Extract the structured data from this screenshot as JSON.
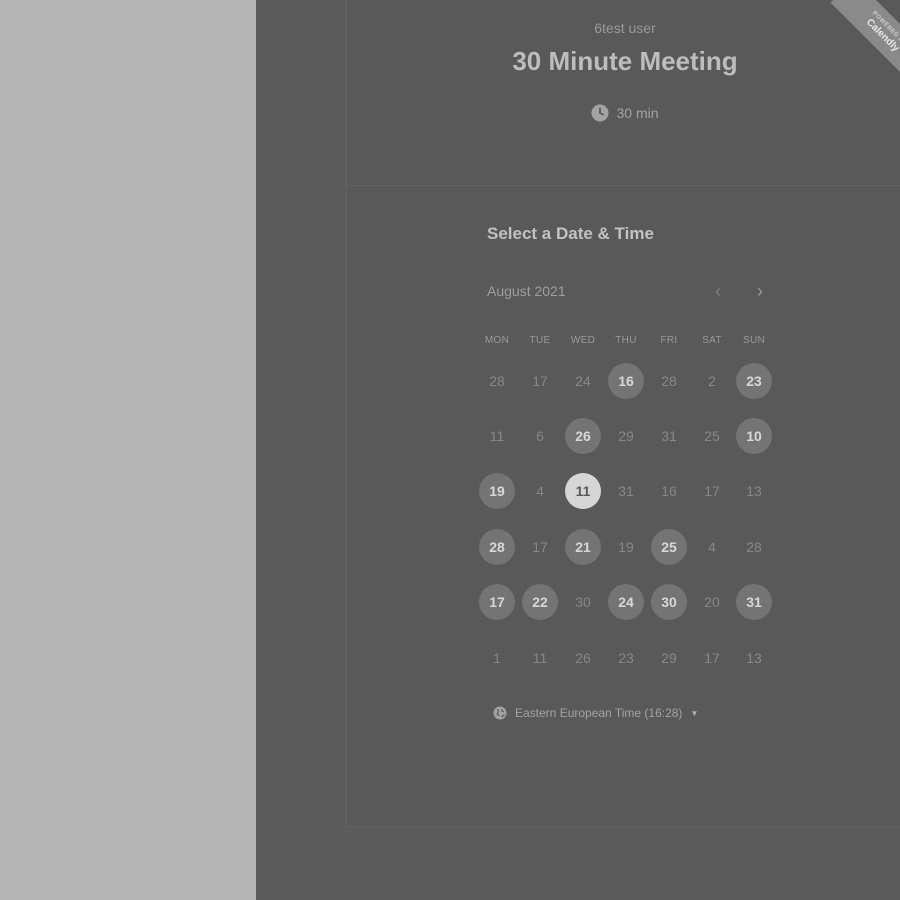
{
  "colors": {
    "left_pane": "#b5b5b5",
    "right_pane": "#5c5c5c",
    "card": "#595959",
    "available_day": "#747474",
    "selected_day": "#d6d6d6"
  },
  "ribbon": {
    "small": "POWERED BY",
    "brand": "Calendly"
  },
  "event": {
    "host": "6test user",
    "title": "30 Minute Meeting",
    "duration": "30 min",
    "duration_icon": "clock-icon"
  },
  "calendar": {
    "heading": "Select a Date & Time",
    "month": "August 2021",
    "prev_icon": "chevron-left-icon",
    "next_icon": "chevron-right-icon",
    "weekdays": [
      "MON",
      "TUE",
      "WED",
      "THU",
      "FRI",
      "SAT",
      "SUN"
    ],
    "weeks": [
      [
        {
          "d": "28",
          "s": "unavailable"
        },
        {
          "d": "17",
          "s": "unavailable"
        },
        {
          "d": "24",
          "s": "unavailable"
        },
        {
          "d": "16",
          "s": "available"
        },
        {
          "d": "28",
          "s": "unavailable"
        },
        {
          "d": "2",
          "s": "unavailable"
        },
        {
          "d": "23",
          "s": "available"
        }
      ],
      [
        {
          "d": "11",
          "s": "unavailable"
        },
        {
          "d": "6",
          "s": "unavailable"
        },
        {
          "d": "26",
          "s": "available"
        },
        {
          "d": "29",
          "s": "unavailable"
        },
        {
          "d": "31",
          "s": "unavailable"
        },
        {
          "d": "25",
          "s": "unavailable"
        },
        {
          "d": "10",
          "s": "available"
        }
      ],
      [
        {
          "d": "19",
          "s": "available"
        },
        {
          "d": "4",
          "s": "unavailable"
        },
        {
          "d": "11",
          "s": "selected"
        },
        {
          "d": "31",
          "s": "unavailable"
        },
        {
          "d": "16",
          "s": "unavailable"
        },
        {
          "d": "17",
          "s": "unavailable"
        },
        {
          "d": "13",
          "s": "unavailable"
        }
      ],
      [
        {
          "d": "28",
          "s": "available"
        },
        {
          "d": "17",
          "s": "unavailable"
        },
        {
          "d": "21",
          "s": "available"
        },
        {
          "d": "19",
          "s": "unavailable"
        },
        {
          "d": "25",
          "s": "available"
        },
        {
          "d": "4",
          "s": "unavailable"
        },
        {
          "d": "28",
          "s": "unavailable"
        }
      ],
      [
        {
          "d": "17",
          "s": "available"
        },
        {
          "d": "22",
          "s": "available"
        },
        {
          "d": "30",
          "s": "unavailable"
        },
        {
          "d": "24",
          "s": "available"
        },
        {
          "d": "30",
          "s": "available"
        },
        {
          "d": "20",
          "s": "unavailable"
        },
        {
          "d": "31",
          "s": "available"
        }
      ],
      [
        {
          "d": "1",
          "s": "unavailable"
        },
        {
          "d": "11",
          "s": "unavailable"
        },
        {
          "d": "26",
          "s": "unavailable"
        },
        {
          "d": "23",
          "s": "unavailable"
        },
        {
          "d": "29",
          "s": "unavailable"
        },
        {
          "d": "17",
          "s": "unavailable"
        },
        {
          "d": "13",
          "s": "unavailable"
        }
      ]
    ]
  },
  "timezone": {
    "label": "Eastern European Time (16:28)",
    "icon": "globe-icon",
    "caret_icon": "caret-down-icon"
  }
}
